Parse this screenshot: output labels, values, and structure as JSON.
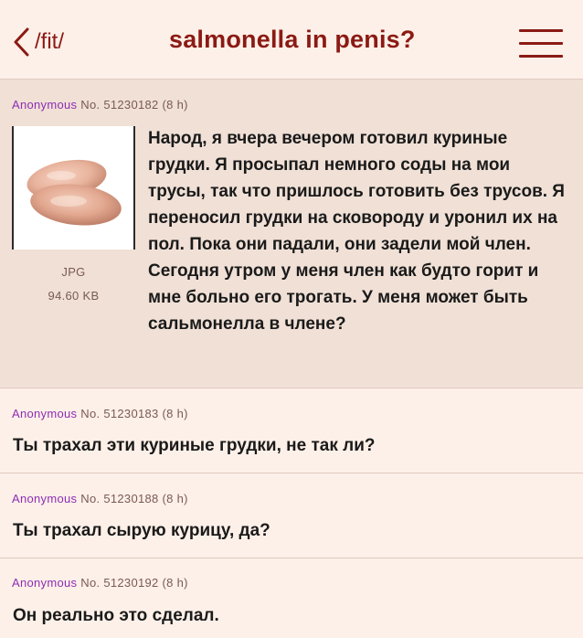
{
  "header": {
    "back_label": "/fit/",
    "title": "salmonella in penis?"
  },
  "op": {
    "name": "Anonymous",
    "no_label": "No.",
    "number": "51230182",
    "time": "(8 h)",
    "file_type": "JPG",
    "file_size": "94.60 KB",
    "text": "Народ, я вчера вечером готовил куриные грудки. Я просыпал немного соды на мои трусы, так что пришлось готовить без трусов. Я переносил грудки на сковороду и уронил их на пол. Пока они падали, они задели мой член. Сегодня утром у меня член как будто горит и мне больно его трогать. У меня может быть сальмонелла в члене?"
  },
  "replies": [
    {
      "name": "Anonymous",
      "no_label": "No.",
      "number": "51230183",
      "time": "(8 h)",
      "text": "Ты трахал эти куриные грудки, не так ли?"
    },
    {
      "name": "Anonymous",
      "no_label": "No.",
      "number": "51230188",
      "time": "(8 h)",
      "text": "Ты трахал сырую курицу, да?"
    },
    {
      "name": "Anonymous",
      "no_label": "No.",
      "number": "51230192",
      "time": "(8 h)",
      "text": "Он реально это сделал."
    }
  ],
  "colors": {
    "accent": "#8b1a14",
    "name": "#8d2eb3",
    "post_bg": "#f0e0d6",
    "reply_bg": "#fdf0e8"
  }
}
